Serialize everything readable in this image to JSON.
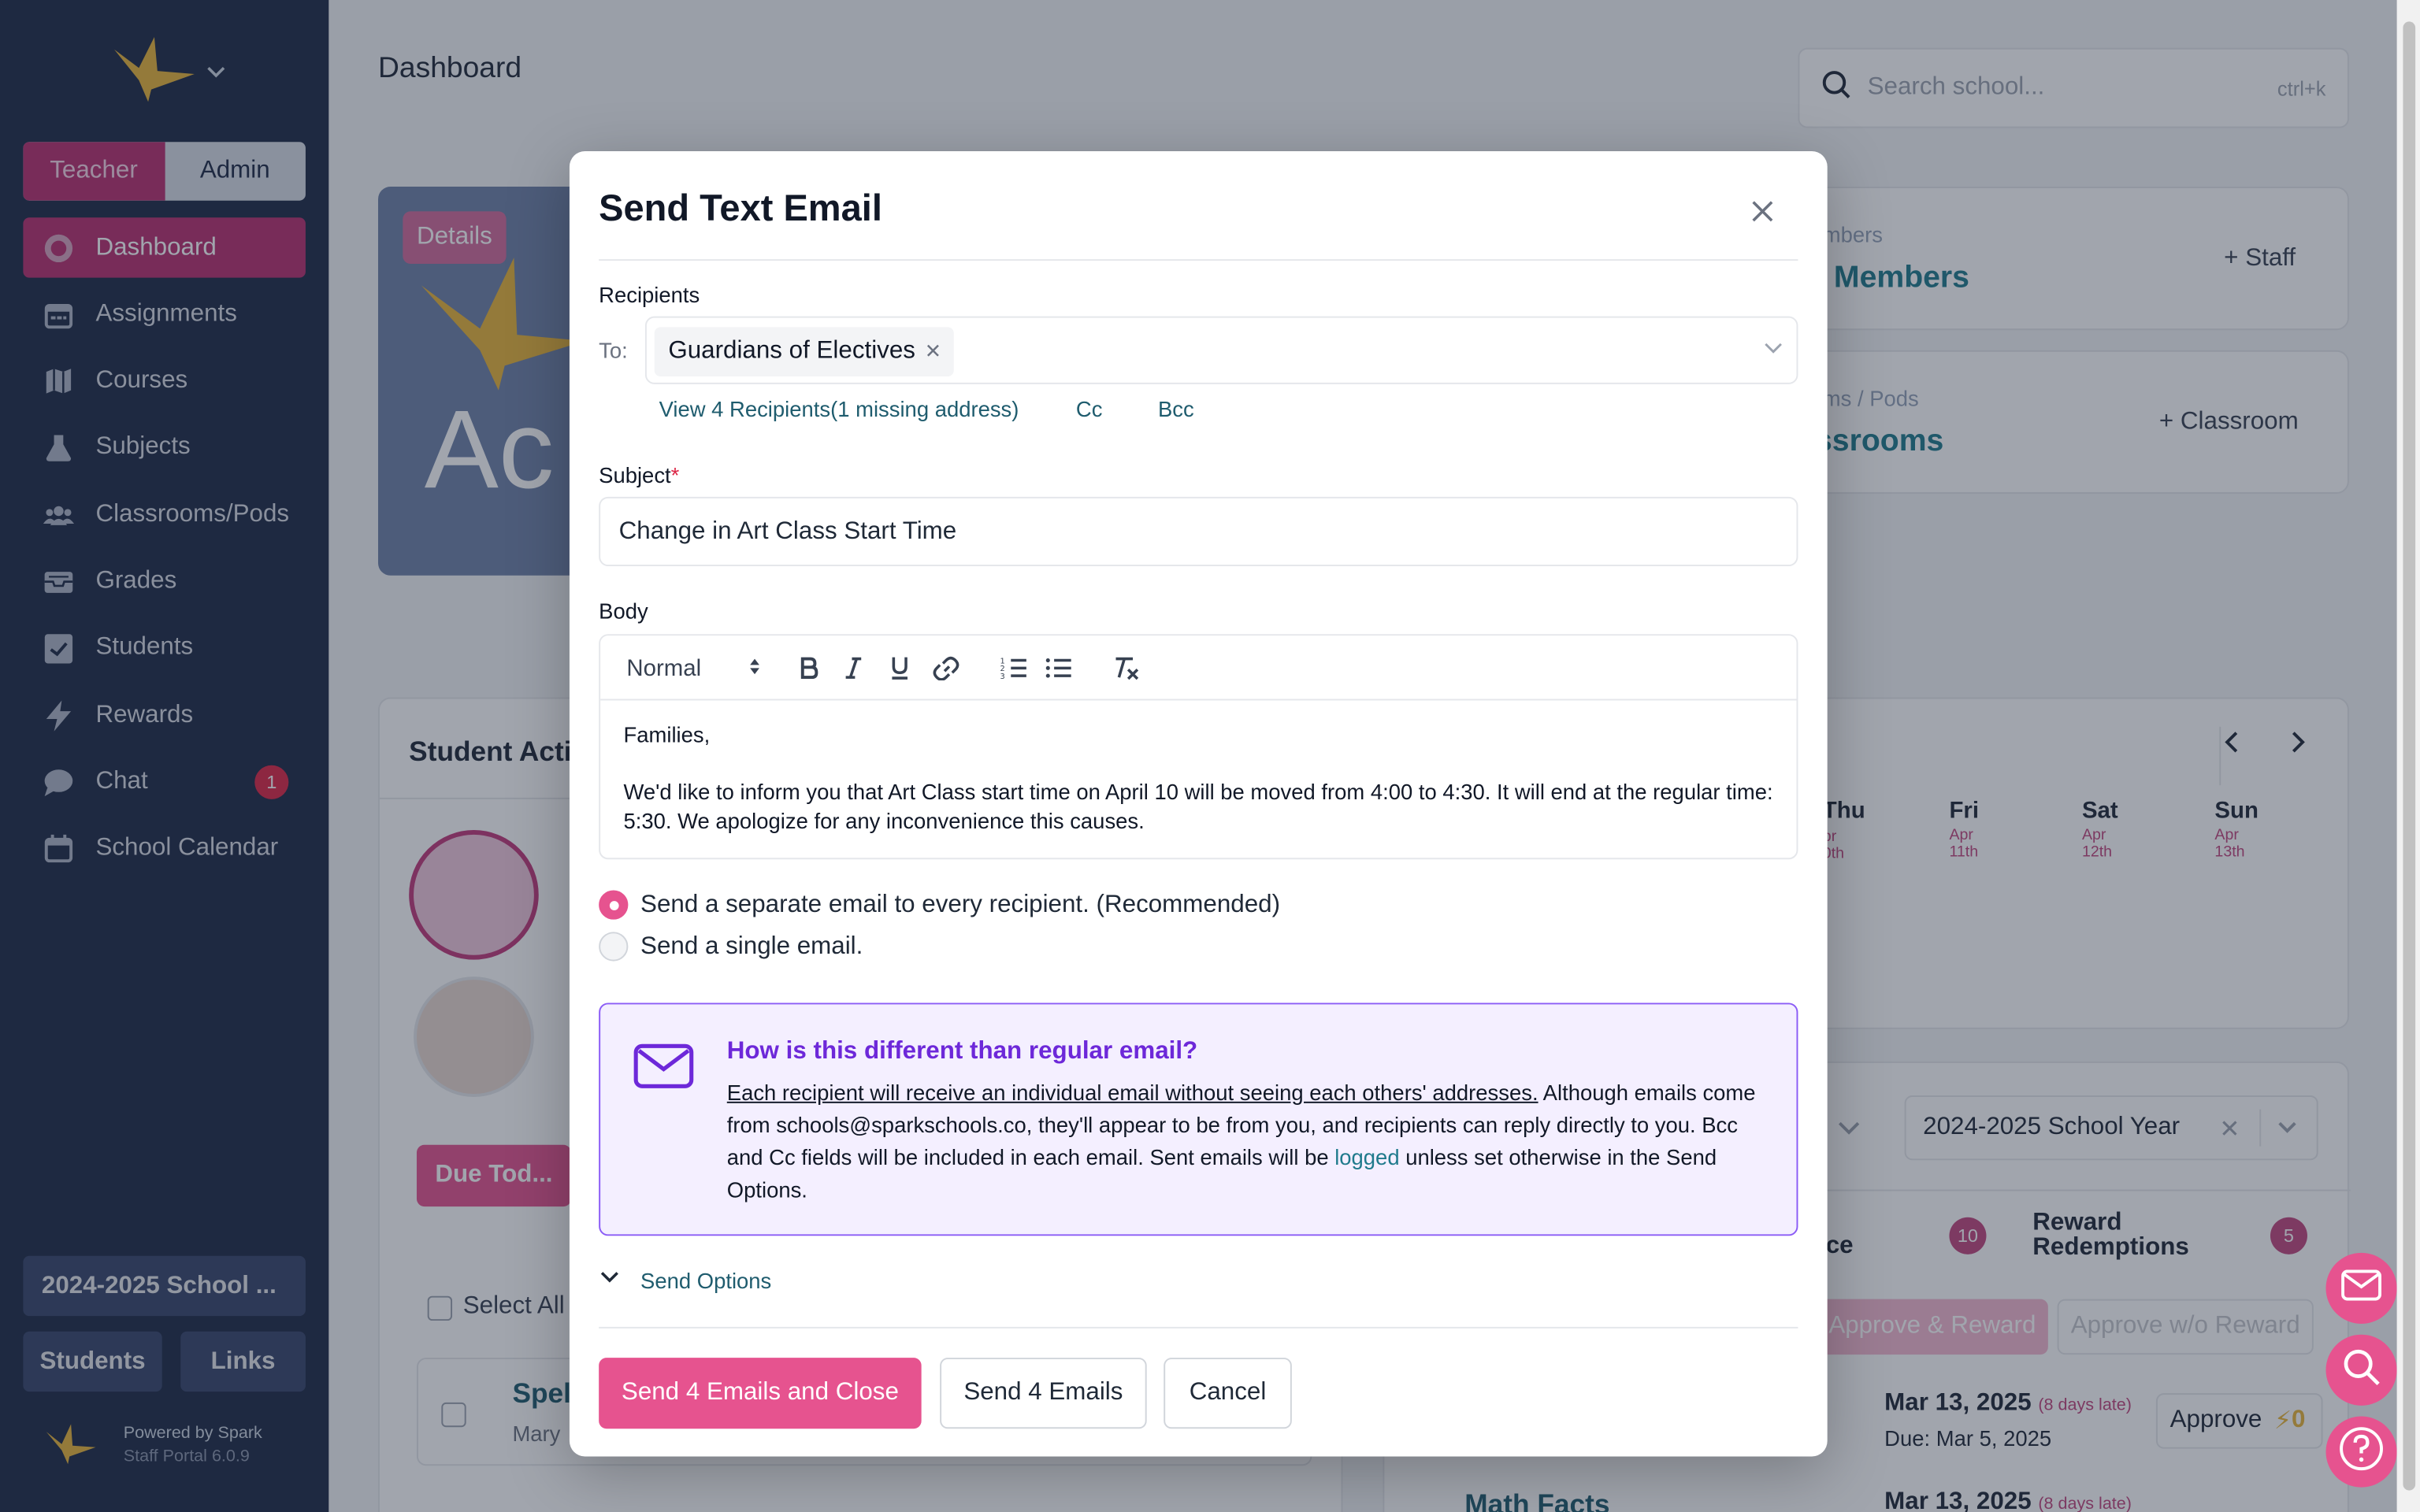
{
  "colors": {
    "sidebar_bg": "#1e2a45",
    "accent": "#b8306f",
    "primary_button": "#e6538f",
    "info_border": "#8b5cf6",
    "info_title": "#6d28d9",
    "link": "#1f7a8c"
  },
  "sidebar": {
    "roles": [
      "Teacher",
      "Admin"
    ],
    "active_role": "Teacher",
    "nav": [
      {
        "label": "Dashboard",
        "icon": "dashboard-icon",
        "active": true
      },
      {
        "label": "Assignments",
        "icon": "calendar-icon"
      },
      {
        "label": "Courses",
        "icon": "map-icon"
      },
      {
        "label": "Subjects",
        "icon": "flask-icon"
      },
      {
        "label": "Classrooms/Pods",
        "icon": "users-icon"
      },
      {
        "label": "Grades",
        "icon": "inbox-icon"
      },
      {
        "label": "Students",
        "icon": "clipboard-check-icon"
      },
      {
        "label": "Rewards",
        "icon": "bolt-icon"
      },
      {
        "label": "Chat",
        "icon": "chat-icon",
        "badge": "1"
      },
      {
        "label": "School Calendar",
        "icon": "calendar-icon"
      }
    ],
    "school_year": "2024-2025 School ...",
    "students_button": "Students",
    "links_button": "Links",
    "powered_by": "Powered by Spark",
    "version": "Staff Portal 6.0.9"
  },
  "main": {
    "page_title": "Dashboard",
    "search": {
      "placeholder": "Search school...",
      "shortcut": "ctrl+k"
    },
    "hero": {
      "details_label": "Details",
      "heading_partial": "Ac"
    },
    "staff_card": {
      "label_partial": "mbers",
      "value_partial": "f Members",
      "action": "+ Staff"
    },
    "classroom_card": {
      "label_partial": "ms / Pods",
      "value_partial": "ssrooms",
      "action": "+ Classroom"
    },
    "student_activity_title": "Student Acti",
    "calendar_days": [
      {
        "day": "Thu",
        "date_partial": "pr 0th"
      },
      {
        "day": "Fri",
        "month": "Apr",
        "date": "11th"
      },
      {
        "day": "Sat",
        "month": "Apr",
        "date": "12th"
      },
      {
        "day": "Sun",
        "month": "Apr",
        "date": "13th"
      }
    ],
    "school_year_select": "2024-2025 School Year",
    "tabs": [
      {
        "label_partial": "ce",
        "count": "10"
      },
      {
        "label": "Reward Redemptions",
        "count": "5"
      }
    ],
    "approve_reward": "Approve & Reward",
    "approve_no_reward": "Approve w/o Reward",
    "due_today_button": "Due Tod...",
    "select_all": "Select All",
    "assignment_partial": "Spel",
    "assignment_student_partial": "Mary",
    "rows": [
      {
        "date": "Mar 13, 2025",
        "late": "(8 days late)",
        "due": "Due: Mar 5, 2025",
        "approve": "Approve",
        "points": "0"
      },
      {
        "title": "Math Facts",
        "date": "Mar 13, 2025",
        "late": "(8 days late)"
      }
    ]
  },
  "modal": {
    "title": "Send Text Email",
    "recipients_label": "Recipients",
    "to_label": "To:",
    "recipient_chip": "Guardians of Electives",
    "view_recipients": "View 4 Recipients(1 missing address)",
    "cc": "Cc",
    "bcc": "Bcc",
    "subject_label": "Subject",
    "subject_value": "Change in Art Class Start Time",
    "body_label": "Body",
    "toolbar_format": "Normal",
    "body_line1": "Families,",
    "body_line2": "We'd like to inform you that Art Class start time on April 10 will be moved from 4:00 to 4:30. It will end at the regular time: 5:30. We apologize for any inconvenience this causes.",
    "options": [
      {
        "label": "Send a separate email to every recipient. (Recommended)",
        "selected": true
      },
      {
        "label": "Send a single email.",
        "selected": false
      }
    ],
    "info_title": "How is this different than regular email?",
    "info_underlined": "Each recipient will receive an individual email without seeing each others' addresses.",
    "info_text_a": " Although emails come from schools@sparkschools.co, they'll appear to be from you, and recipients can reply directly to you. Bcc and Cc fields will be included in each email. Sent emails will be ",
    "info_link": "logged",
    "info_text_b": " unless set otherwise in the Send Options.",
    "send_options": "Send Options",
    "btn_send_close": "Send 4 Emails and Close",
    "btn_send": "Send 4 Emails",
    "btn_cancel": "Cancel"
  }
}
